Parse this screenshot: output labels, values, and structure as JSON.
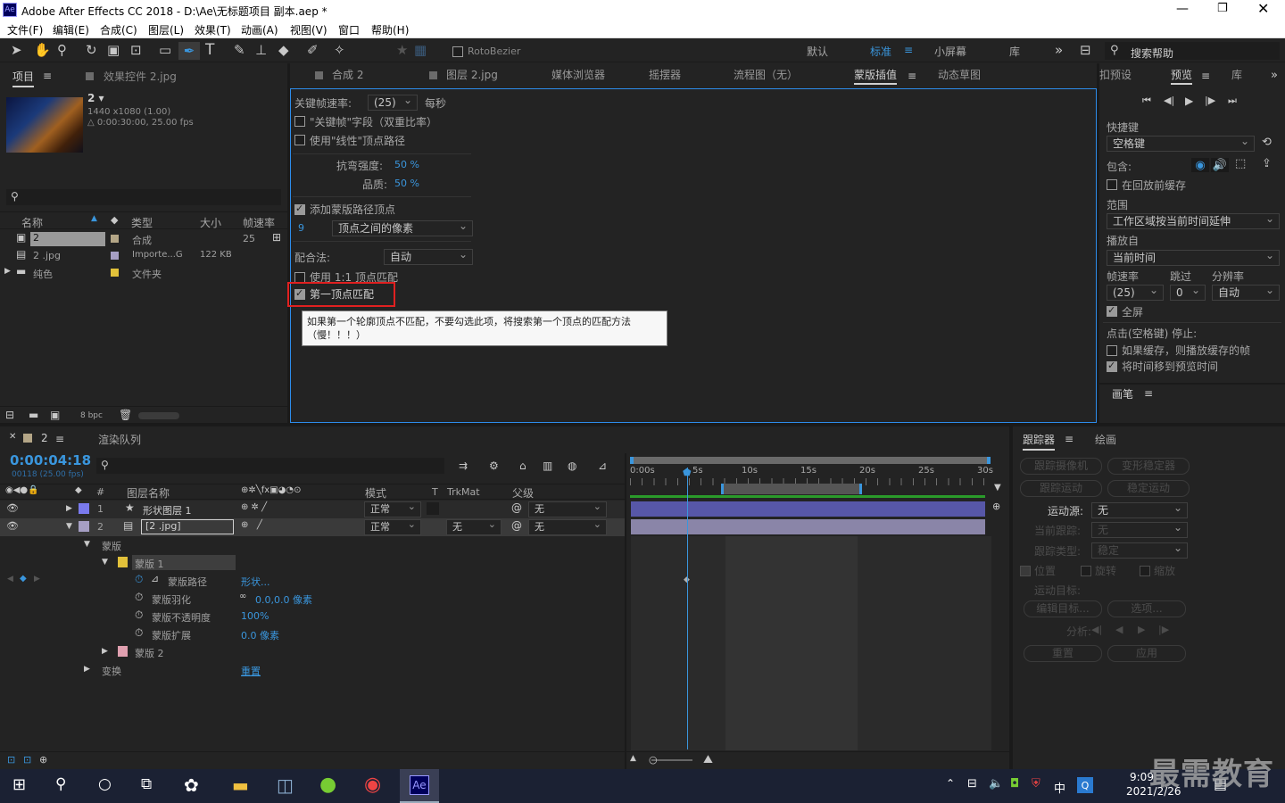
{
  "title_bar": {
    "app_icon": "Ae",
    "title": "Adobe After Effects CC 2018 - D:\\Ae\\无标题项目 副本.aep *"
  },
  "menu": [
    "文件(F)",
    "编辑(E)",
    "合成(C)",
    "图层(L)",
    "效果(T)",
    "动画(A)",
    "视图(V)",
    "窗口",
    "帮助(H)"
  ],
  "toolbar": {
    "rotobezier": "RotoBezier",
    "workspaces": [
      "默认",
      "标准",
      "小屏幕",
      "库"
    ],
    "search_help": "搜索帮助"
  },
  "project_panel": {
    "tab_project": "项目",
    "tab_effects": "效果控件 2.jpg",
    "comp_name": "2 ▾",
    "comp_info1": "1440 x1080 (1.00)",
    "comp_info2": "△ 0:00:30:00, 25.00 fps",
    "col_name": "名称",
    "col_type": "类型",
    "col_size": "大小",
    "col_fps": "帧速率",
    "items": [
      {
        "name": "2",
        "type": "合成",
        "size": "",
        "fps": "25"
      },
      {
        "name": "2 .jpg",
        "type": "Importe...G",
        "size": "122 KB",
        "fps": ""
      },
      {
        "name": "纯色",
        "type": "文件夹",
        "size": "",
        "fps": ""
      }
    ],
    "bpc": "8 bpc"
  },
  "center_tabs": [
    "合成 2",
    "图层 2.jpg",
    "媒体浏览器",
    "摇摆器",
    "流程图（无）",
    "蒙版插值",
    "动态草图"
  ],
  "mask_interp": {
    "kf_rate_label": "关键帧速率:",
    "kf_rate": "(25)",
    "per_sec": "每秒",
    "kf_fields": "\"关键帧\"字段（双重比率）",
    "linear": "使用\"线性\"顶点路径",
    "bend_label": "抗弯强度:",
    "bend_val": "50 %",
    "quality_label": "品质:",
    "quality_val": "50 %",
    "add_vertices": "添加蒙版路径顶点",
    "vert_num": "9",
    "vert_mode": "顶点之间的像素",
    "match_label": "配合法:",
    "match_val": "自动",
    "use_1to1": "使用 1:1 顶点匹配",
    "first_vertex": "第一顶点匹配",
    "tooltip": "如果第一个轮廓顶点不匹配，不要勾选此项，将搜索第一个顶点的匹配方法（慢！！！）"
  },
  "preview_panel": {
    "tabs": [
      "扣预设",
      "预览",
      "库"
    ],
    "shortcut_label": "快捷键",
    "shortcut_val": "空格键",
    "include_label": "包含:",
    "cache_before": "在回放前缓存",
    "range_label": "范围",
    "range_val": "工作区域按当前时间延伸",
    "play_from_label": "播放自",
    "play_from_val": "当前时间",
    "fps_label": "帧速率",
    "skip_label": "跳过",
    "res_label": "分辨率",
    "fps_val": "(25)",
    "skip_val": "0",
    "res_val": "自动",
    "fullscreen": "全屏",
    "stop_label": "点击(空格键) 停止:",
    "if_cache": "如果缓存，则播放缓存的帧",
    "move_time": "将时间移到预览时间",
    "brush_tab": "画笔"
  },
  "timeline": {
    "comp_tab": "2",
    "render_tab": "渲染队列",
    "timecode": "0:00:04:18",
    "timecode_sub": "00118 (25.00 fps)",
    "col_layer": "图层名称",
    "col_mode": "模式",
    "col_t": "T",
    "col_trkmat": "TrkMat",
    "col_parent": "父级",
    "ruler": [
      "0:00s",
      "5s",
      "10s",
      "15s",
      "20s",
      "25s",
      "30s"
    ],
    "layers": [
      {
        "num": "1",
        "name": "形状图层 1",
        "mode": "正常",
        "trk": "",
        "parent": "无"
      },
      {
        "num": "2",
        "name": "[2 .jpg]",
        "mode": "正常",
        "trk": "无",
        "parent": "无"
      }
    ],
    "mask_group": "蒙版",
    "mask1": "蒙版 1",
    "props": [
      {
        "name": "蒙版路径",
        "val": "形状..."
      },
      {
        "name": "蒙版羽化",
        "val": "0.0,0.0 像素"
      },
      {
        "name": "蒙版不透明度",
        "val": "100%"
      },
      {
        "name": "蒙版扩展",
        "val": "0.0 像素"
      }
    ],
    "mask2": "蒙版 2",
    "transform": "变换",
    "transform_val": "重置"
  },
  "tracker": {
    "tab_tracker": "跟踪器",
    "tab_paint": "绘画",
    "btn_track_camera": "跟踪摄像机",
    "btn_warp": "变形稳定器",
    "btn_track_motion": "跟踪运动",
    "btn_stabilize": "稳定运动",
    "motion_source_label": "运动源:",
    "motion_source_val": "无",
    "current_track_label": "当前跟踪:",
    "current_track_val": "无",
    "track_type_label": "跟踪类型:",
    "track_type_val": "稳定",
    "position": "位置",
    "rotation": "旋转",
    "scale": "缩放",
    "motion_target": "运动目标:",
    "edit_target": "编辑目标...",
    "options": "选项...",
    "analyze": "分析:",
    "reset": "重置",
    "apply": "应用"
  },
  "taskbar": {
    "time": "9:09",
    "date": "2021/2/26",
    "ime": "中",
    "watermark": "最需教育"
  }
}
